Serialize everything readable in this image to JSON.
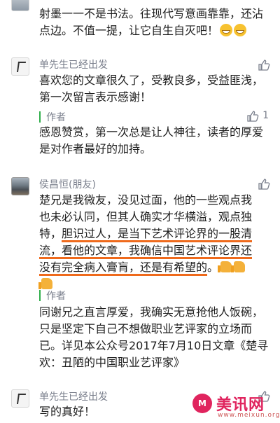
{
  "comments": [
    {
      "text": "射墨一一不是书法。往现代写意画靠靠，还沾点边。不值一提，让它自生自灭吧！"
    },
    {
      "name": "单先生已经出发",
      "text": "喜欢您的文章很久了，受教良多，受益匪浅，第一次留言表示感谢！",
      "reply_label": "作者",
      "reply_likes": "1",
      "reply_text": "感恩赞赏，第一次总是让人神往，读者的厚爱是对作者最好的加持。"
    },
    {
      "name": "侯昌恒(朋友)",
      "text_line1": "楚兄是我微友，没见过面，他的一些观点我",
      "text_line2": "也未必认同，但其人确实才华横溢，观点独",
      "text_line3_a": "特，",
      "text_line3_hl": "胆识过人，是当下艺术评论界的一股清",
      "text_line4_hl": "流，看他的文章，我确信中国艺术评论界还",
      "text_line5_hl": "没有完全病入膏肓，还是有希望的",
      "text_line5_end": "。",
      "reply_label": "作者",
      "reply_text": "同谢兄之直言厚爱，我确实无意抢他人饭碗，只是坚定下自己不想做职业艺评家的立场而已。详见本公众号2017年7月10日文章《楚寻欢：丑陋的中国职业艺评家》"
    },
    {
      "name": "单先生已经出发",
      "text": "写的真好！"
    }
  ],
  "watermark": {
    "logo": "M",
    "name": "美讯网",
    "url": "www.meixun.org"
  },
  "colors": {
    "author_bar": "#2fae4a",
    "highlight": "#ef6a1c",
    "name": "#7a7f8c"
  }
}
